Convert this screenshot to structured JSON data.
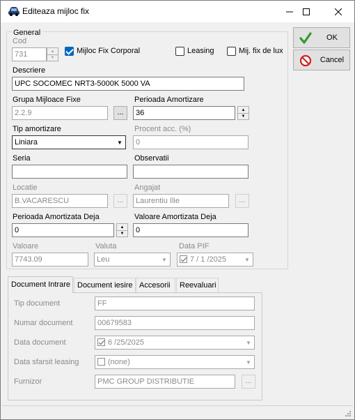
{
  "window": {
    "title": "Editeaza mijloc fix"
  },
  "actions": {
    "ok_label": "OK",
    "cancel_label": "Cancel"
  },
  "general": {
    "group_title": "General",
    "cod_label": "Cod",
    "cod_value": "731",
    "corporal_label": "Mijloc Fix Corporal",
    "corporal_checked": true,
    "leasing_label": "Leasing",
    "leasing_checked": false,
    "lux_label": "Mij. fix de lux",
    "lux_checked": false,
    "descriere_label": "Descriere",
    "descriere_value": "UPC SOCOMEC NRT3-5000K 5000 VA",
    "grupa_label": "Grupa Mijloace Fixe",
    "grupa_value": "2.2.9",
    "perioada_label": "Perioada Amortizare",
    "perioada_value": "36",
    "tip_label": "Tip amortizare",
    "tip_value": "Liniara",
    "procent_label": "Procent acc. (%)",
    "procent_value": "0",
    "seria_label": "Seria",
    "seria_value": "",
    "observatii_label": "Observatii",
    "observatii_value": "",
    "locatie_label": "Locatie",
    "locatie_value": "B.VACARESCU",
    "angajat_label": "Angajat",
    "angajat_value": "Laurentiu Ilie",
    "perioada_deja_label": "Perioada Amortizata Deja",
    "perioada_deja_value": "0",
    "valoare_deja_label": "Valoare Amortizata Deja",
    "valoare_deja_value": "0",
    "valoare_label": "Valoare",
    "valoare_value": "7743.09",
    "valuta_label": "Valuta",
    "valuta_value": "Leu",
    "data_pif_label": "Data PIF",
    "data_pif_value": "7 / 1 /2025",
    "ellipsis": "..."
  },
  "tabs": [
    {
      "label": "Document Intrare",
      "active": true
    },
    {
      "label": "Document iesire",
      "active": false
    },
    {
      "label": "Accesorii",
      "active": false
    },
    {
      "label": "Reevaluari",
      "active": false
    }
  ],
  "document": {
    "tip_label": "Tip document",
    "tip_value": "FF",
    "numar_label": "Numar document",
    "numar_value": "00679583",
    "data_label": "Data document",
    "data_value": "6 /25/2025",
    "sfarsit_label": "Data sfarsit leasing",
    "sfarsit_value": "(none)",
    "furnizor_label": "Furnizor",
    "furnizor_value": "PMC GROUP DISTRIBUTIE"
  },
  "colors": {
    "accent": "#0067c0",
    "ok_icon": "#2e9a2e",
    "cancel_icon": "#d42020"
  },
  "icons": [
    "car-icon",
    "minimize-icon",
    "maximize-icon",
    "close-icon",
    "checkmark-icon",
    "no-entry-icon",
    "chevron-down-icon",
    "size-grip-icon"
  ]
}
